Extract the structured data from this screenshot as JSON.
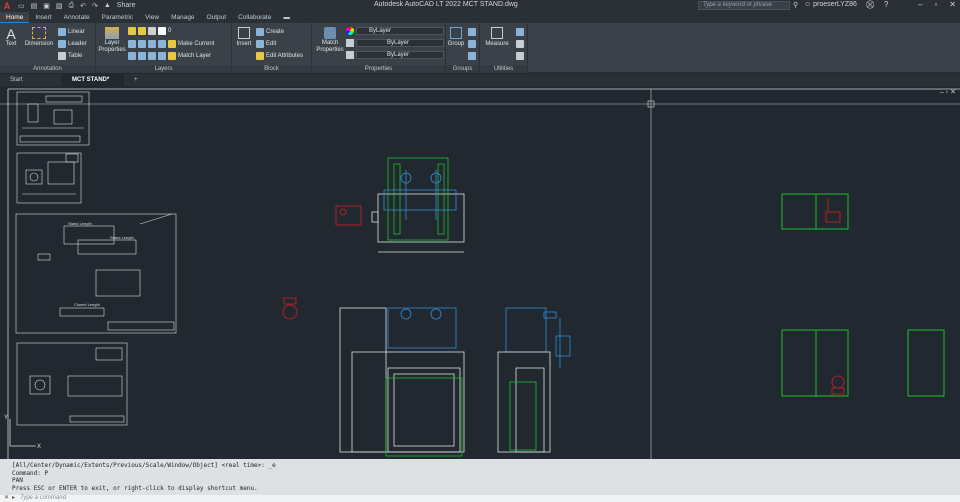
{
  "titlebar": {
    "logo": "A",
    "title": "Autodesk AutoCAD LT 2022    MCT STAND.dwg",
    "search_placeholder": "Type a keyword or phrase",
    "user": "proeserLYZ86",
    "share": "Share"
  },
  "menu": [
    "Home",
    "Insert",
    "Annotate",
    "Parametric",
    "View",
    "Manage",
    "Output",
    "Collaborate"
  ],
  "ribbon": {
    "annotation": {
      "title": "Annotation",
      "text": "Text",
      "dimension": "Dimension",
      "linear": "Linear",
      "leader": "Leader",
      "table": "Table"
    },
    "layers": {
      "title": "Layers",
      "layer_properties": "Layer Properties",
      "make_current": "Make Current",
      "match_layer": "Match Layer",
      "layer_value": "0"
    },
    "block": {
      "title": "Block",
      "insert": "Insert",
      "create": "Create",
      "edit": "Edit",
      "edit_attributes": "Edit Attributes"
    },
    "properties": {
      "title": "Properties",
      "match_properties": "Match Properties",
      "color": "ByLayer",
      "linetype": "ByLayer",
      "lineweight": "ByLayer"
    },
    "groups": {
      "title": "Groups",
      "group": "Group"
    },
    "utilities": {
      "title": "Utilities",
      "measure": "Measure"
    }
  },
  "doc_tabs": {
    "start": "Start",
    "active": "MCT STAND*"
  },
  "command": {
    "history": [
      "[All/Center/Dynamic/Extents/Previous/Scale/Window/Object] <real time>: _e",
      "Command: P",
      "PAN",
      "Press ESC or ENTER to exit, or right-click to display shortcut menu."
    ],
    "placeholder": "Type a command"
  },
  "drawing": {
    "labels": [
      "Stand Length",
      "Stand Length",
      "Closed Length"
    ],
    "ucs_x": "X",
    "ucs_y": "Y"
  },
  "colors": {
    "green": "#1fbf2a",
    "blue": "#2f8fd8",
    "red": "#d21f24",
    "white": "#e6e6e6"
  }
}
